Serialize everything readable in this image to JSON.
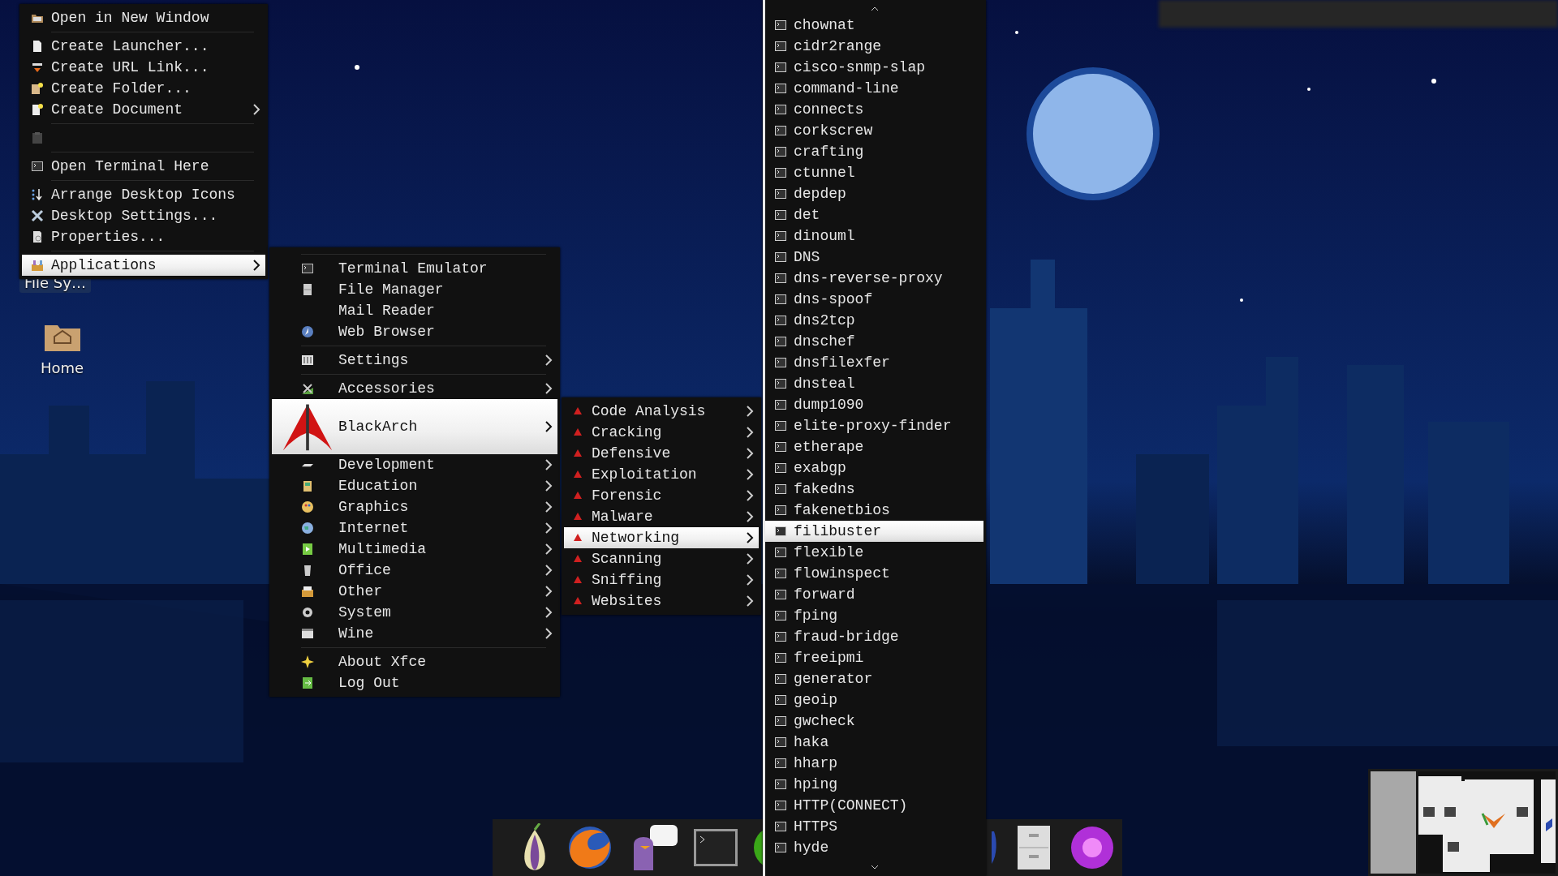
{
  "desktop": {
    "icons": [
      {
        "label": "File Sy…",
        "kind": "label"
      },
      {
        "label": "Home",
        "kind": "folder"
      }
    ]
  },
  "menus": [
    {
      "items": [
        {
          "kind": "item",
          "label": "Open in New Window",
          "selected": false
        },
        {
          "kind": "separator"
        },
        {
          "kind": "item",
          "label": "Create Launcher...",
          "selected": false
        },
        {
          "kind": "item",
          "label": "Create URL Link...",
          "selected": false
        },
        {
          "kind": "item",
          "label": "Create Folder...",
          "selected": false
        },
        {
          "kind": "item",
          "label": "Create Document",
          "submenu": true,
          "selected": false
        },
        {
          "kind": "separator"
        },
        {
          "kind": "disabled"
        },
        {
          "kind": "separator"
        },
        {
          "kind": "item",
          "label": "Open Terminal Here",
          "selected": false
        },
        {
          "kind": "separator"
        },
        {
          "kind": "item",
          "label": "Arrange Desktop Icons",
          "selected": false
        },
        {
          "kind": "item",
          "label": "Desktop Settings...",
          "selected": false
        },
        {
          "kind": "item",
          "label": "Properties...",
          "selected": false
        },
        {
          "kind": "separator"
        },
        {
          "kind": "item",
          "label": "Applications",
          "submenu": true,
          "selected": true
        }
      ]
    },
    {
      "items": [
        {
          "kind": "separator"
        },
        {
          "kind": "item",
          "label": "Terminal Emulator",
          "selected": false
        },
        {
          "kind": "item",
          "label": "File Manager",
          "selected": false
        },
        {
          "kind": "item",
          "label": "Mail Reader",
          "selected": false
        },
        {
          "kind": "item",
          "label": "Web Browser",
          "selected": false
        },
        {
          "kind": "separator"
        },
        {
          "kind": "item",
          "label": "Settings",
          "submenu": true,
          "selected": false
        },
        {
          "kind": "separator"
        },
        {
          "kind": "item",
          "label": "Accessories",
          "submenu": true,
          "selected": false
        },
        {
          "kind": "large",
          "label": "BlackArch",
          "submenu": true,
          "selected": true
        },
        {
          "kind": "item",
          "label": "Development",
          "submenu": true,
          "selected": false
        },
        {
          "kind": "item",
          "label": "Education",
          "submenu": true,
          "selected": false
        },
        {
          "kind": "item",
          "label": "Graphics",
          "submenu": true,
          "selected": false
        },
        {
          "kind": "item",
          "label": "Internet",
          "submenu": true,
          "selected": false
        },
        {
          "kind": "item",
          "label": "Multimedia",
          "submenu": true,
          "selected": false
        },
        {
          "kind": "item",
          "label": "Office",
          "submenu": true,
          "selected": false
        },
        {
          "kind": "item",
          "label": "Other",
          "submenu": true,
          "selected": false
        },
        {
          "kind": "item",
          "label": "System",
          "submenu": true,
          "selected": false
        },
        {
          "kind": "item",
          "label": "Wine",
          "submenu": true,
          "selected": false
        },
        {
          "kind": "separator"
        },
        {
          "kind": "item",
          "label": "About Xfce",
          "selected": false
        },
        {
          "kind": "item",
          "label": "Log Out",
          "selected": false
        }
      ]
    },
    {
      "items": [
        {
          "kind": "item",
          "label": "Code Analysis",
          "submenu": true,
          "selected": false
        },
        {
          "kind": "item",
          "label": "Cracking",
          "submenu": true,
          "selected": false
        },
        {
          "kind": "item",
          "label": "Defensive",
          "submenu": true,
          "selected": false
        },
        {
          "kind": "item",
          "label": "Exploitation",
          "submenu": true,
          "selected": false
        },
        {
          "kind": "item",
          "label": "Forensic",
          "submenu": true,
          "selected": false
        },
        {
          "kind": "item",
          "label": "Malware",
          "submenu": true,
          "selected": false
        },
        {
          "kind": "item",
          "label": "Networking",
          "submenu": true,
          "selected": true
        },
        {
          "kind": "item",
          "label": "Scanning",
          "submenu": true,
          "selected": false
        },
        {
          "kind": "item",
          "label": "Sniffing",
          "submenu": true,
          "selected": false
        },
        {
          "kind": "item",
          "label": "Websites",
          "submenu": true,
          "selected": false
        }
      ]
    },
    {
      "scrollable": true,
      "items": [
        {
          "kind": "item",
          "label": "chownat",
          "selected": false
        },
        {
          "kind": "item",
          "label": "cidr2range",
          "selected": false
        },
        {
          "kind": "item",
          "label": "cisco-snmp-slap",
          "selected": false
        },
        {
          "kind": "item",
          "label": "command-line",
          "selected": false
        },
        {
          "kind": "item",
          "label": "connects",
          "selected": false
        },
        {
          "kind": "item",
          "label": "corkscrew",
          "selected": false
        },
        {
          "kind": "item",
          "label": "crafting",
          "selected": false
        },
        {
          "kind": "item",
          "label": "ctunnel",
          "selected": false
        },
        {
          "kind": "item",
          "label": "depdep",
          "selected": false
        },
        {
          "kind": "item",
          "label": "det",
          "selected": false
        },
        {
          "kind": "item",
          "label": "dinouml",
          "selected": false
        },
        {
          "kind": "item",
          "label": "DNS",
          "selected": false
        },
        {
          "kind": "item",
          "label": "dns-reverse-proxy",
          "selected": false
        },
        {
          "kind": "item",
          "label": "dns-spoof",
          "selected": false
        },
        {
          "kind": "item",
          "label": "dns2tcp",
          "selected": false
        },
        {
          "kind": "item",
          "label": "dnschef",
          "selected": false
        },
        {
          "kind": "item",
          "label": "dnsfilexfer",
          "selected": false
        },
        {
          "kind": "item",
          "label": "dnsteal",
          "selected": false
        },
        {
          "kind": "item",
          "label": "dump1090",
          "selected": false
        },
        {
          "kind": "item",
          "label": "elite-proxy-finder",
          "selected": false
        },
        {
          "kind": "item",
          "label": "etherape",
          "selected": false
        },
        {
          "kind": "item",
          "label": "exabgp",
          "selected": false
        },
        {
          "kind": "item",
          "label": "fakedns",
          "selected": false
        },
        {
          "kind": "item",
          "label": "fakenetbios",
          "selected": false
        },
        {
          "kind": "item",
          "label": "filibuster",
          "selected": true
        },
        {
          "kind": "item",
          "label": "flexible",
          "selected": false
        },
        {
          "kind": "item",
          "label": "flowinspect",
          "selected": false
        },
        {
          "kind": "item",
          "label": "forward",
          "selected": false
        },
        {
          "kind": "item",
          "label": "fping",
          "selected": false
        },
        {
          "kind": "item",
          "label": "fraud-bridge",
          "selected": false
        },
        {
          "kind": "item",
          "label": "freeipmi",
          "selected": false
        },
        {
          "kind": "item",
          "label": "generator",
          "selected": false
        },
        {
          "kind": "item",
          "label": "geoip",
          "selected": false
        },
        {
          "kind": "item",
          "label": "gwcheck",
          "selected": false
        },
        {
          "kind": "item",
          "label": "haka",
          "selected": false
        },
        {
          "kind": "item",
          "label": "hharp",
          "selected": false
        },
        {
          "kind": "item",
          "label": "hping",
          "selected": false
        },
        {
          "kind": "item",
          "label": "HTTP(CONNECT)",
          "selected": false
        },
        {
          "kind": "item",
          "label": "HTTPS",
          "selected": false
        },
        {
          "kind": "item",
          "label": "hyde",
          "selected": false
        }
      ]
    }
  ]
}
